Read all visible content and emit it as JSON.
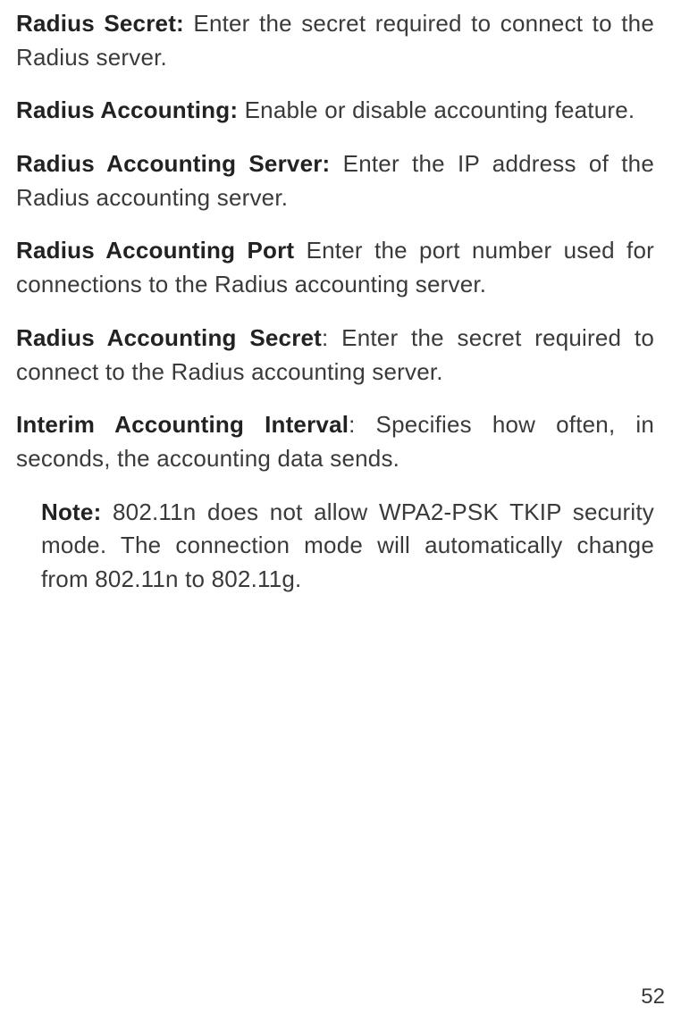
{
  "entries": [
    {
      "term": "Radius Secret:",
      "desc": " Enter the secret required to connect to the Radius server."
    },
    {
      "term": "Radius Accounting:",
      "desc": " Enable or disable accounting feature."
    },
    {
      "term": "Radius Accounting Server:",
      "desc": " Enter the IP address of the Radius accounting server."
    },
    {
      "term": "Radius Accounting Port",
      "desc": " Enter the port number used for connections to the Radius accounting server."
    },
    {
      "term": "Radius Accounting Secret",
      "desc": ": Enter the secret required to connect to the Radius accounting server."
    },
    {
      "term": "Interim Accounting Interval",
      "desc": ": Specifies how often, in seconds, the accounting data sends."
    }
  ],
  "note": {
    "term": "Note:",
    "desc": " 802.11n does not allow WPA2-PSK TKIP security mode. The connection mode will automatically change from 802.11n to 802.11g."
  },
  "page_number": "52"
}
